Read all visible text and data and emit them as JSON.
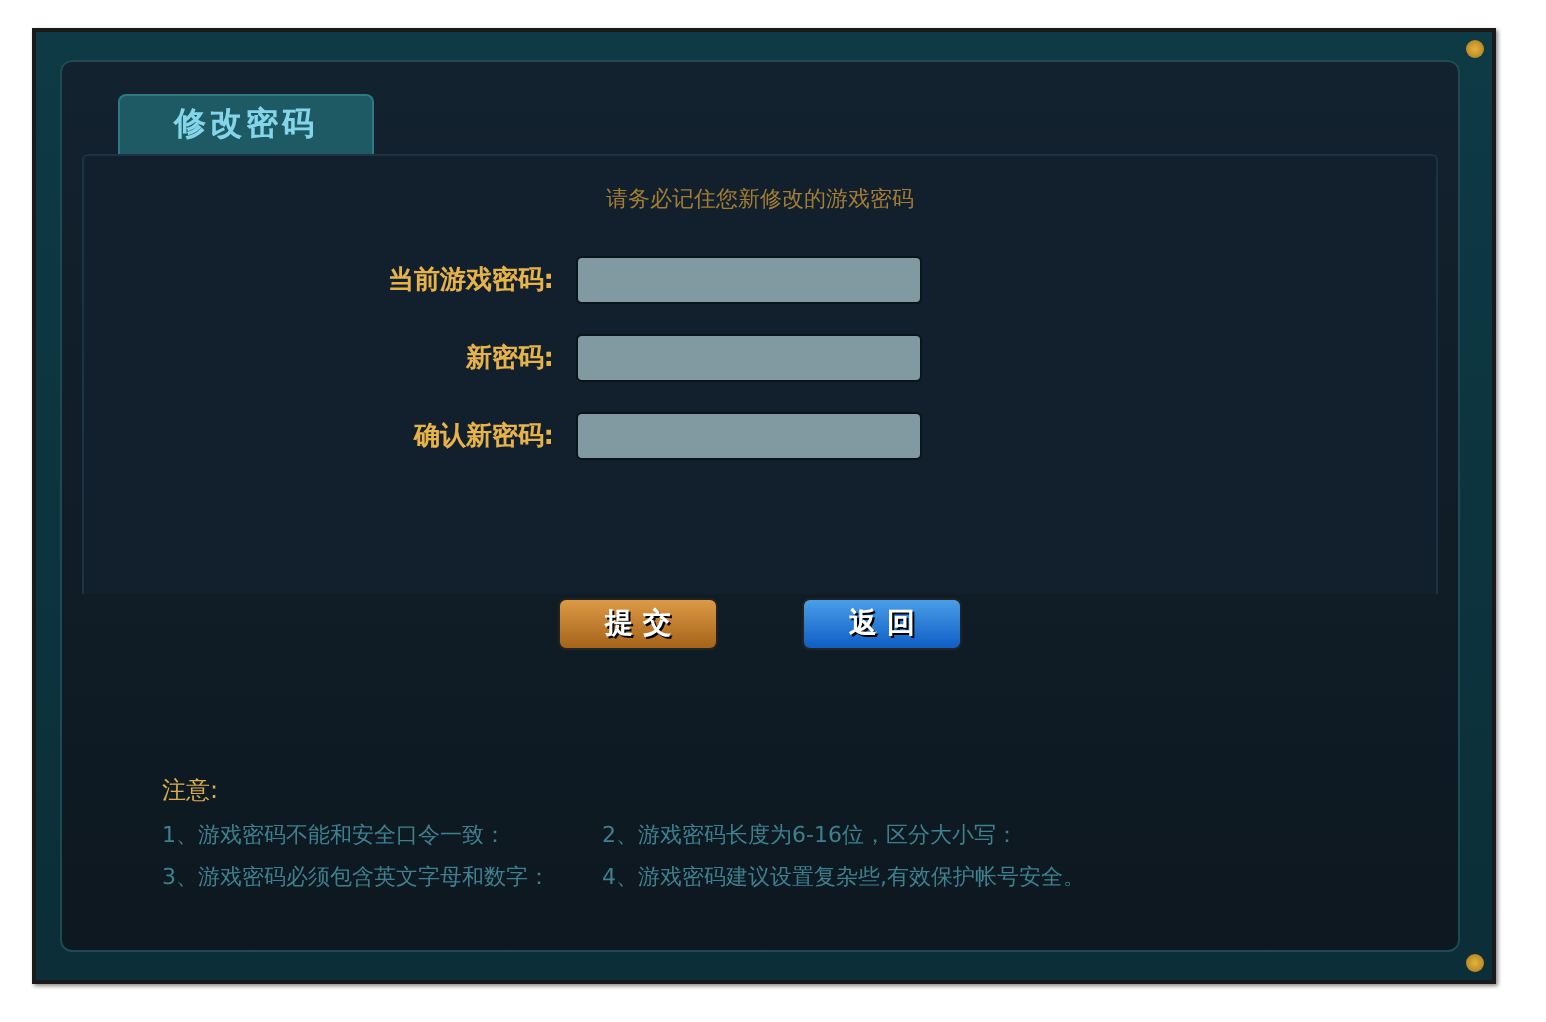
{
  "tabs": [
    {
      "label": "修改密码",
      "selected": true
    }
  ],
  "hint": "请务必记住您新修改的游戏密码",
  "fields": [
    {
      "label": "当前游戏密码:"
    },
    {
      "label": "新密码:"
    },
    {
      "label": "确认新密码:"
    }
  ],
  "buttons": [
    {
      "label": "提 交",
      "kind": "submit"
    },
    {
      "label": "返 回",
      "kind": "back"
    }
  ],
  "notes": {
    "title": "注意:",
    "items": [
      "1、游戏密码不能和安全口令一致：",
      "2、游戏密码长度为6-16位，区分大小写：",
      "3、游戏密码必须包含英文字母和数字：",
      "4、游戏密码建议设置复杂些,有效保护帐号安全。"
    ]
  }
}
